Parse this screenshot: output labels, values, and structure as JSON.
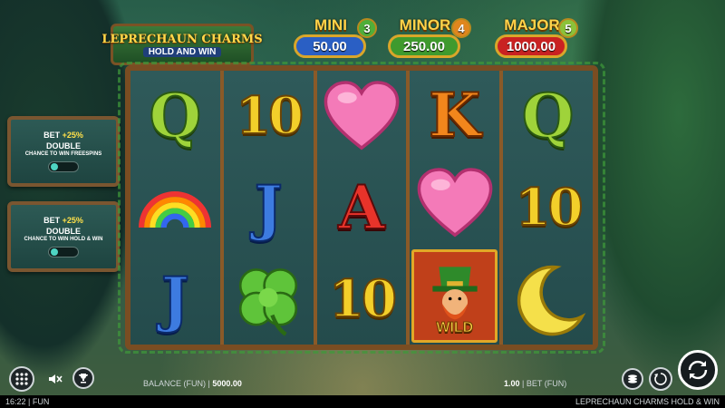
{
  "logo": {
    "title": "LEPRECHAUN CHARMS",
    "subtitle": "HOLD AND WIN"
  },
  "jackpots": [
    {
      "name": "MINI",
      "value": "50.00",
      "badge": "3",
      "color": "#2a5fc4",
      "badge_color": "#4fae3a"
    },
    {
      "name": "MINOR",
      "value": "250.00",
      "badge": "4",
      "color": "#3f9a2e",
      "badge_color": "#e0861e"
    },
    {
      "name": "MAJOR",
      "value": "1000.00",
      "badge": "5",
      "color": "#c92222",
      "badge_color": "#8bc23a"
    }
  ],
  "side_features": [
    {
      "bet": "BET",
      "bet_pct": "+25%",
      "double": "DOUBLE",
      "desc": "CHANCE TO WIN FREESPINS"
    },
    {
      "bet": "BET",
      "bet_pct": "+25%",
      "double": "DOUBLE",
      "desc": "CHANCE TO WIN HOLD & WIN"
    }
  ],
  "reels": [
    [
      {
        "symbol": "Q",
        "kind": "letter",
        "style": "green"
      },
      {
        "symbol": "rainbow",
        "kind": "icon"
      },
      {
        "symbol": "J",
        "kind": "letter",
        "style": "blue"
      }
    ],
    [
      {
        "symbol": "10",
        "kind": "num",
        "style": "gold"
      },
      {
        "symbol": "J",
        "kind": "letter",
        "style": "blue"
      },
      {
        "symbol": "clover",
        "kind": "icon"
      }
    ],
    [
      {
        "symbol": "heart",
        "kind": "icon"
      },
      {
        "symbol": "A",
        "kind": "letter",
        "style": "red"
      },
      {
        "symbol": "10",
        "kind": "num",
        "style": "gold"
      }
    ],
    [
      {
        "symbol": "K",
        "kind": "letter",
        "style": "orange"
      },
      {
        "symbol": "heart",
        "kind": "icon"
      },
      {
        "symbol": "wild",
        "kind": "wild",
        "label": "WILD"
      }
    ],
    [
      {
        "symbol": "Q",
        "kind": "letter",
        "style": "green"
      },
      {
        "symbol": "10",
        "kind": "num",
        "style": "gold"
      },
      {
        "symbol": "moon",
        "kind": "icon"
      }
    ]
  ],
  "controls": {
    "menu_icon": "grid-menu-icon",
    "sound_icon": "mute-icon",
    "trophy_icon": "trophy-icon",
    "stack_icon": "coin-stack-icon",
    "autoplay_icon": "autoplay-icon",
    "spin_icon": "spin-icon"
  },
  "balance": {
    "label": "BALANCE (FUN)",
    "value": "5000.00"
  },
  "bet": {
    "value": "1.00",
    "label": "BET (FUN)"
  },
  "status": {
    "time": "16:22",
    "mode": "FUN",
    "game_name": "LEPRECHAUN CHARMS HOLD & WIN"
  }
}
